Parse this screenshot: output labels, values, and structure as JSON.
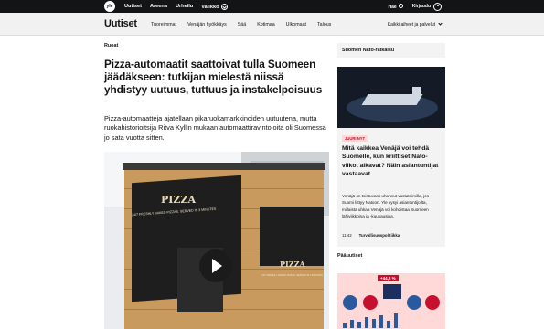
{
  "topbar": {
    "logo": "yle",
    "nav": [
      "Uutiset",
      "Areena",
      "Urheilu",
      "Valikko"
    ],
    "search_label": "Hae",
    "login_label": "Kirjaudu"
  },
  "section_nav": {
    "brand": "Uutiset",
    "items": [
      "Tuoreimmat",
      "Venäjän hyökkäys",
      "Sää",
      "Kotimaa",
      "Ulkomaat",
      "Talous"
    ],
    "all_topics": "Kaikki aiheet ja palvelut"
  },
  "article": {
    "kicker": "Ruoat",
    "headline": "Pizza-automaatit saattoivat tulla Suomeen jäädäkseen: tutkijan mielestä niissä yhdistyy uutuus, tuttuus ja instakelpoisuus",
    "lead": "Pizza-automaatteja ajatellaan pikaruokamarkkinoiden uutuutena, mutta ruokahistorioitsija Ritva Kyllin mukaan automaattiravintoloita oli Suomessa jo sata vuotta sitten.",
    "image_texts": {
      "pizza_main": "PIZZA",
      "pizza_side": "PIZZA",
      "stripe_main": "24/7 FRESHLY BAKED PIZZAS. SERVED IN 3 MINUTES",
      "stripe_side": "24/7 FRESHLY BAKED PIZZAS. SERVED IN 3 MINUTES"
    }
  },
  "sidebar": {
    "section_title": "Suomen Nato-ratkaisu",
    "badge": "JUURI NYT",
    "story_title": "Mitä kaikkea Venäjä voi tehdä Suomelle, kun kriittiset Nato-viikot alkavat? Näin asiantuntijat vastaavat",
    "summary": "Venäjä on toistuvasti uhannut vastatoimilla, jos Suomi liittyy Natoon. Yle kysyi asiantuntijoilta, millaista uhkaa Venäjä voi kohdistaa Suomeen lähiviikkoina ja -kuukausina.",
    "time": "11:42",
    "tag": "Turvallisuuspolitiikka",
    "main_news_title": "Pääuutiset",
    "main_news_chip": "+44,2 %"
  },
  "colors": {
    "topbar_bg": "#131415",
    "badge_text": "#c8102e",
    "badge_bg": "#ffd8d8",
    "nav_bg": "#f1f1f1"
  }
}
